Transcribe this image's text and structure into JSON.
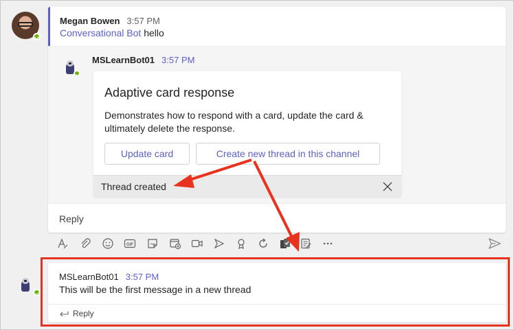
{
  "message1": {
    "sender": "Megan Bowen",
    "time": "3:57 PM",
    "mention": "Conversational Bot",
    "text": "hello"
  },
  "bot_reply": {
    "sender": "MSLearnBot01",
    "time": "3:57 PM"
  },
  "card": {
    "title": "Adaptive card response",
    "description": "Demonstrates how to respond with a card, update the card & ultimately delete the response.",
    "buttons": {
      "update": "Update card",
      "new_thread": "Create new thread in this channel"
    },
    "status": "Thread created"
  },
  "reply_box": {
    "label": "Reply"
  },
  "toolbar": {
    "icons": [
      "format-icon",
      "attach-icon",
      "emoji-icon",
      "gif-icon",
      "sticker-icon",
      "meet-icon",
      "video-icon",
      "stream-icon",
      "praise-icon",
      "loop-icon",
      "approvals-icon",
      "forms-icon",
      "more-icon"
    ]
  },
  "message2": {
    "sender": "MSLearnBot01",
    "time": "3:57 PM",
    "text": "This will be the first message in a new thread",
    "reply_label": "Reply"
  },
  "colors": {
    "accent": "#5b5fc7",
    "annotation": "#e8321e",
    "presence": "#6bb700"
  }
}
